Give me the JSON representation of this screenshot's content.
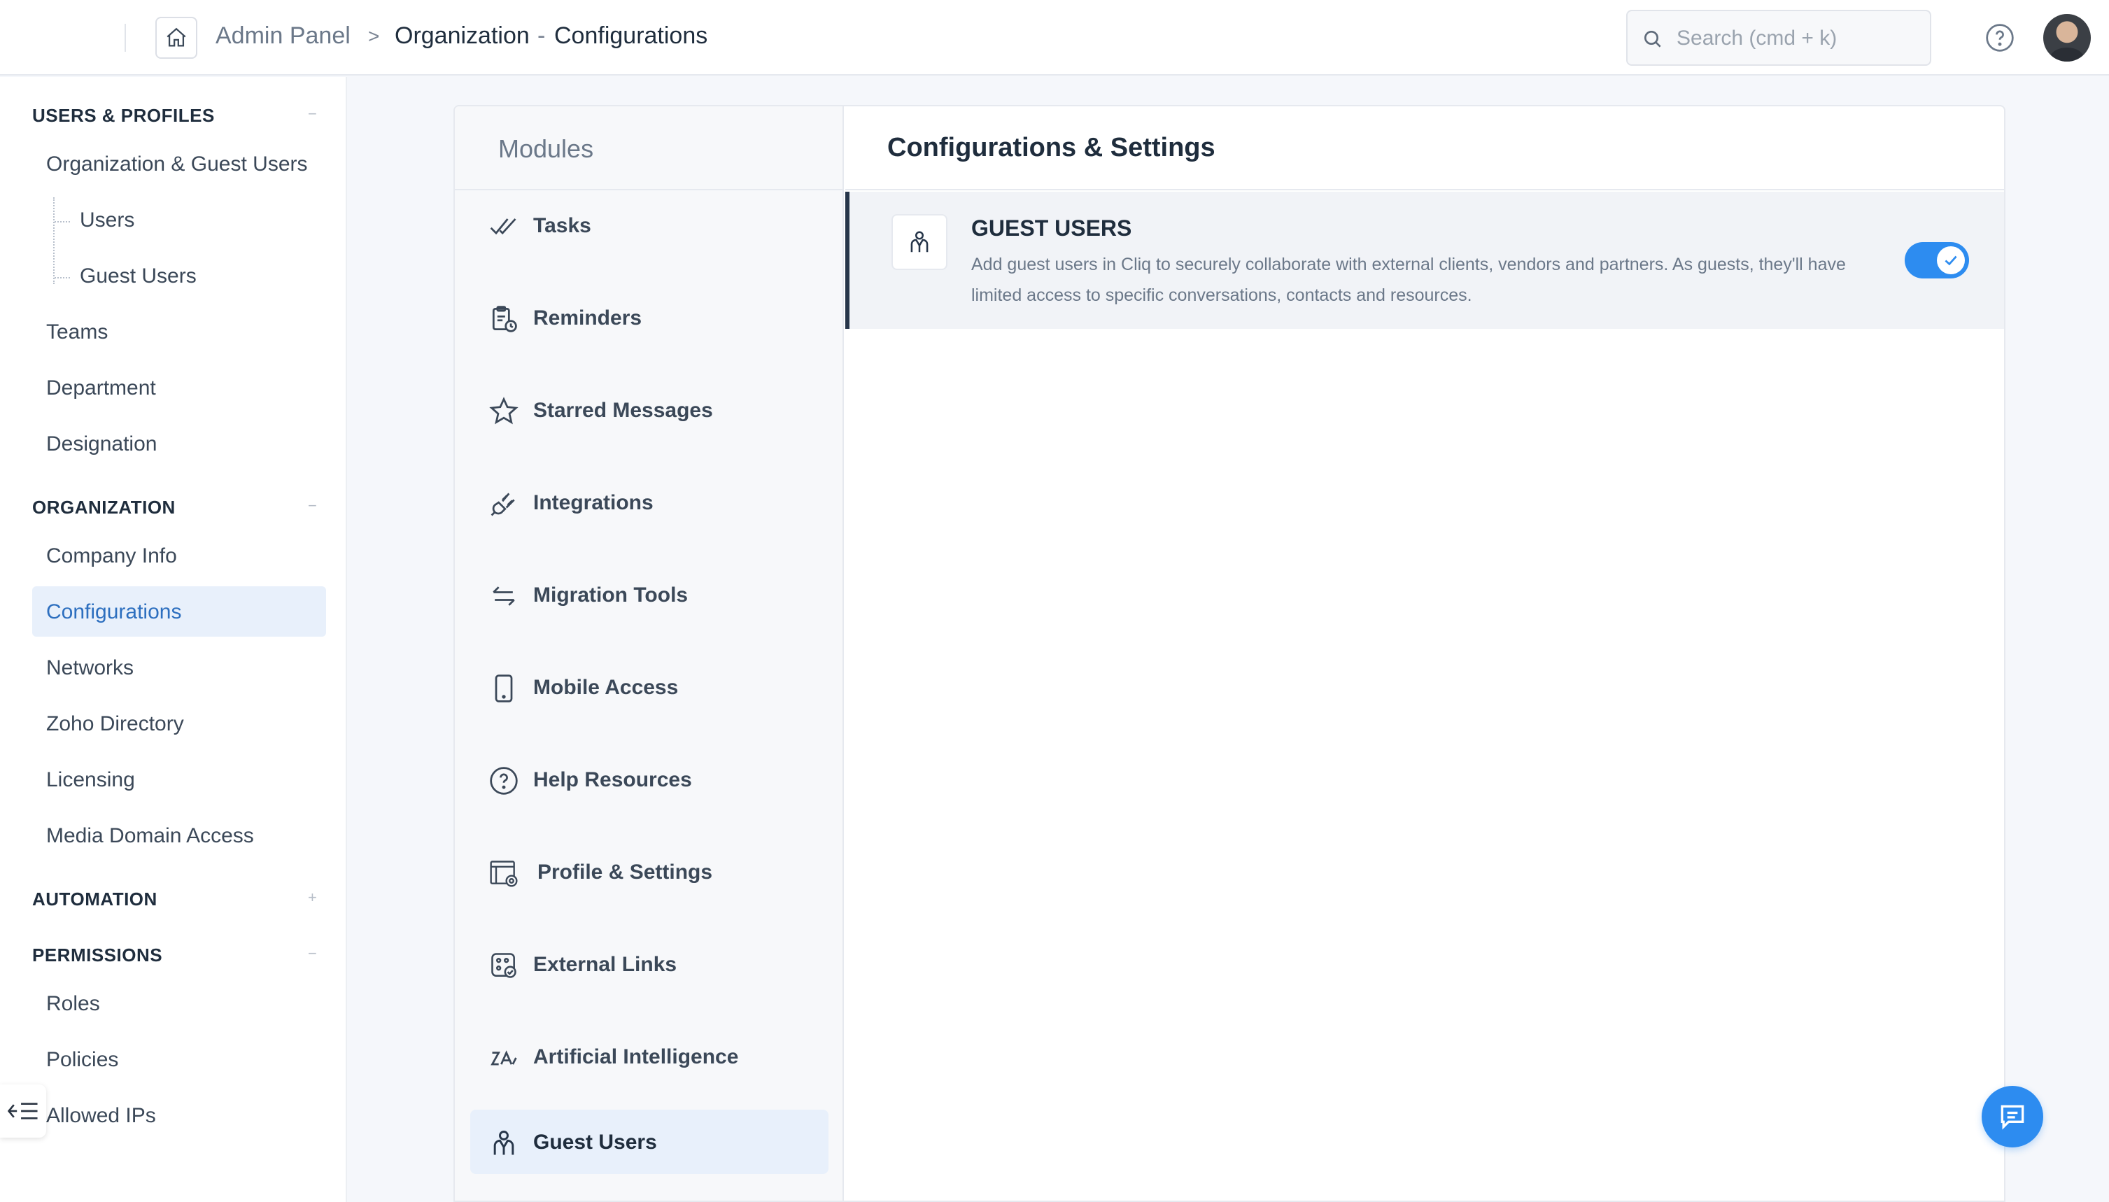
{
  "header": {
    "breadcrumb_root": "Admin Panel",
    "breadcrumb_sep": ">",
    "breadcrumb_section": "Organization",
    "breadcrumb_dash": "-",
    "breadcrumb_page": "Configurations",
    "search_placeholder": "Search (cmd + k)"
  },
  "sidebar": {
    "sections": [
      {
        "title": "USERS & PROFILES",
        "toggle": "−",
        "items": [
          "Organization & Guest Users",
          "Users",
          "Guest Users",
          "Teams",
          "Department",
          "Designation"
        ]
      },
      {
        "title": "ORGANIZATION",
        "toggle": "−",
        "items": [
          "Company Info",
          "Configurations",
          "Networks",
          "Zoho Directory",
          "Licensing",
          "Media Domain Access"
        ]
      },
      {
        "title": "AUTOMATION",
        "toggle": "+",
        "items": []
      },
      {
        "title": "PERMISSIONS",
        "toggle": "−",
        "items": [
          "Roles",
          "Policies",
          "Allowed IPs"
        ]
      }
    ],
    "active_item": "Configurations"
  },
  "modules": {
    "title": "Modules",
    "items": [
      {
        "label": "Tasks",
        "icon": "tasks-icon"
      },
      {
        "label": "Reminders",
        "icon": "reminders-icon"
      },
      {
        "label": "Starred Messages",
        "icon": "star-icon"
      },
      {
        "label": "Integrations",
        "icon": "plug-icon"
      },
      {
        "label": "Migration Tools",
        "icon": "migration-icon"
      },
      {
        "label": "Mobile Access",
        "icon": "mobile-icon"
      },
      {
        "label": "Help Resources",
        "icon": "help-icon"
      },
      {
        "label": "Profile & Settings",
        "icon": "profile-settings-icon"
      },
      {
        "label": "External Links",
        "icon": "external-links-icon"
      },
      {
        "label": "Artificial Intelligence",
        "icon": "ai-icon"
      },
      {
        "label": "Guest Users",
        "icon": "guest-user-icon"
      }
    ],
    "active": "Guest Users"
  },
  "settings": {
    "title": "Configurations & Settings",
    "guest_users": {
      "title": "GUEST USERS",
      "description": "Add guest users in Cliq to securely collaborate with external clients, vendors and partners. As guests, they'll have limited access to specific conversations, contacts and resources.",
      "enabled": true
    }
  },
  "colors": {
    "accent": "#2d8cf0",
    "active_bg": "#e8f0fb",
    "active_text": "#2d6fbf"
  }
}
